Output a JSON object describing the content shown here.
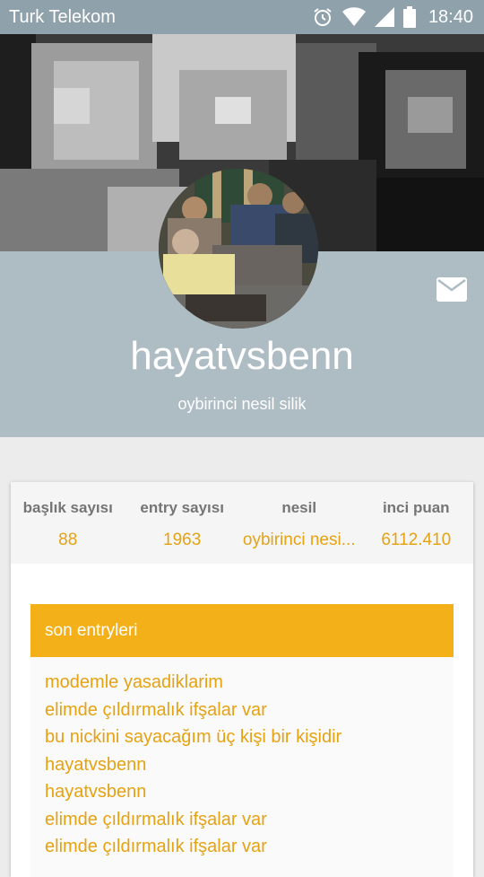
{
  "status_bar": {
    "carrier": "Turk Telekom",
    "time": "18:40",
    "icons": [
      "alarm-icon",
      "wifi-icon",
      "signal-icon",
      "battery-icon"
    ]
  },
  "profile": {
    "username": "hayatvsbenn",
    "subtitle": "oybirinci nesil silik",
    "message_icon": "mail-icon"
  },
  "stats": [
    {
      "label": "başlık sayısı",
      "value": "88"
    },
    {
      "label": "entry sayısı",
      "value": "1963"
    },
    {
      "label": "nesil",
      "value": "oybirinci nesi..."
    },
    {
      "label": "inci puan",
      "value": "6112.410"
    }
  ],
  "entries": {
    "title": "son entryleri",
    "items": [
      "modemle yasadiklarim",
      "elimde çıldırmalık ifşalar var",
      "bu nickini sayacağım üç kişi bir kişidir",
      "hayatvsbenn",
      "hayatvsbenn",
      "elimde çıldırmalık ifşalar var",
      "elimde çıldırmalık ifşalar var"
    ]
  },
  "colors": {
    "status_bar": "#8fa1ab",
    "profile_band": "#aebcc4",
    "accent": "#f4b018",
    "link": "#e5a213"
  }
}
